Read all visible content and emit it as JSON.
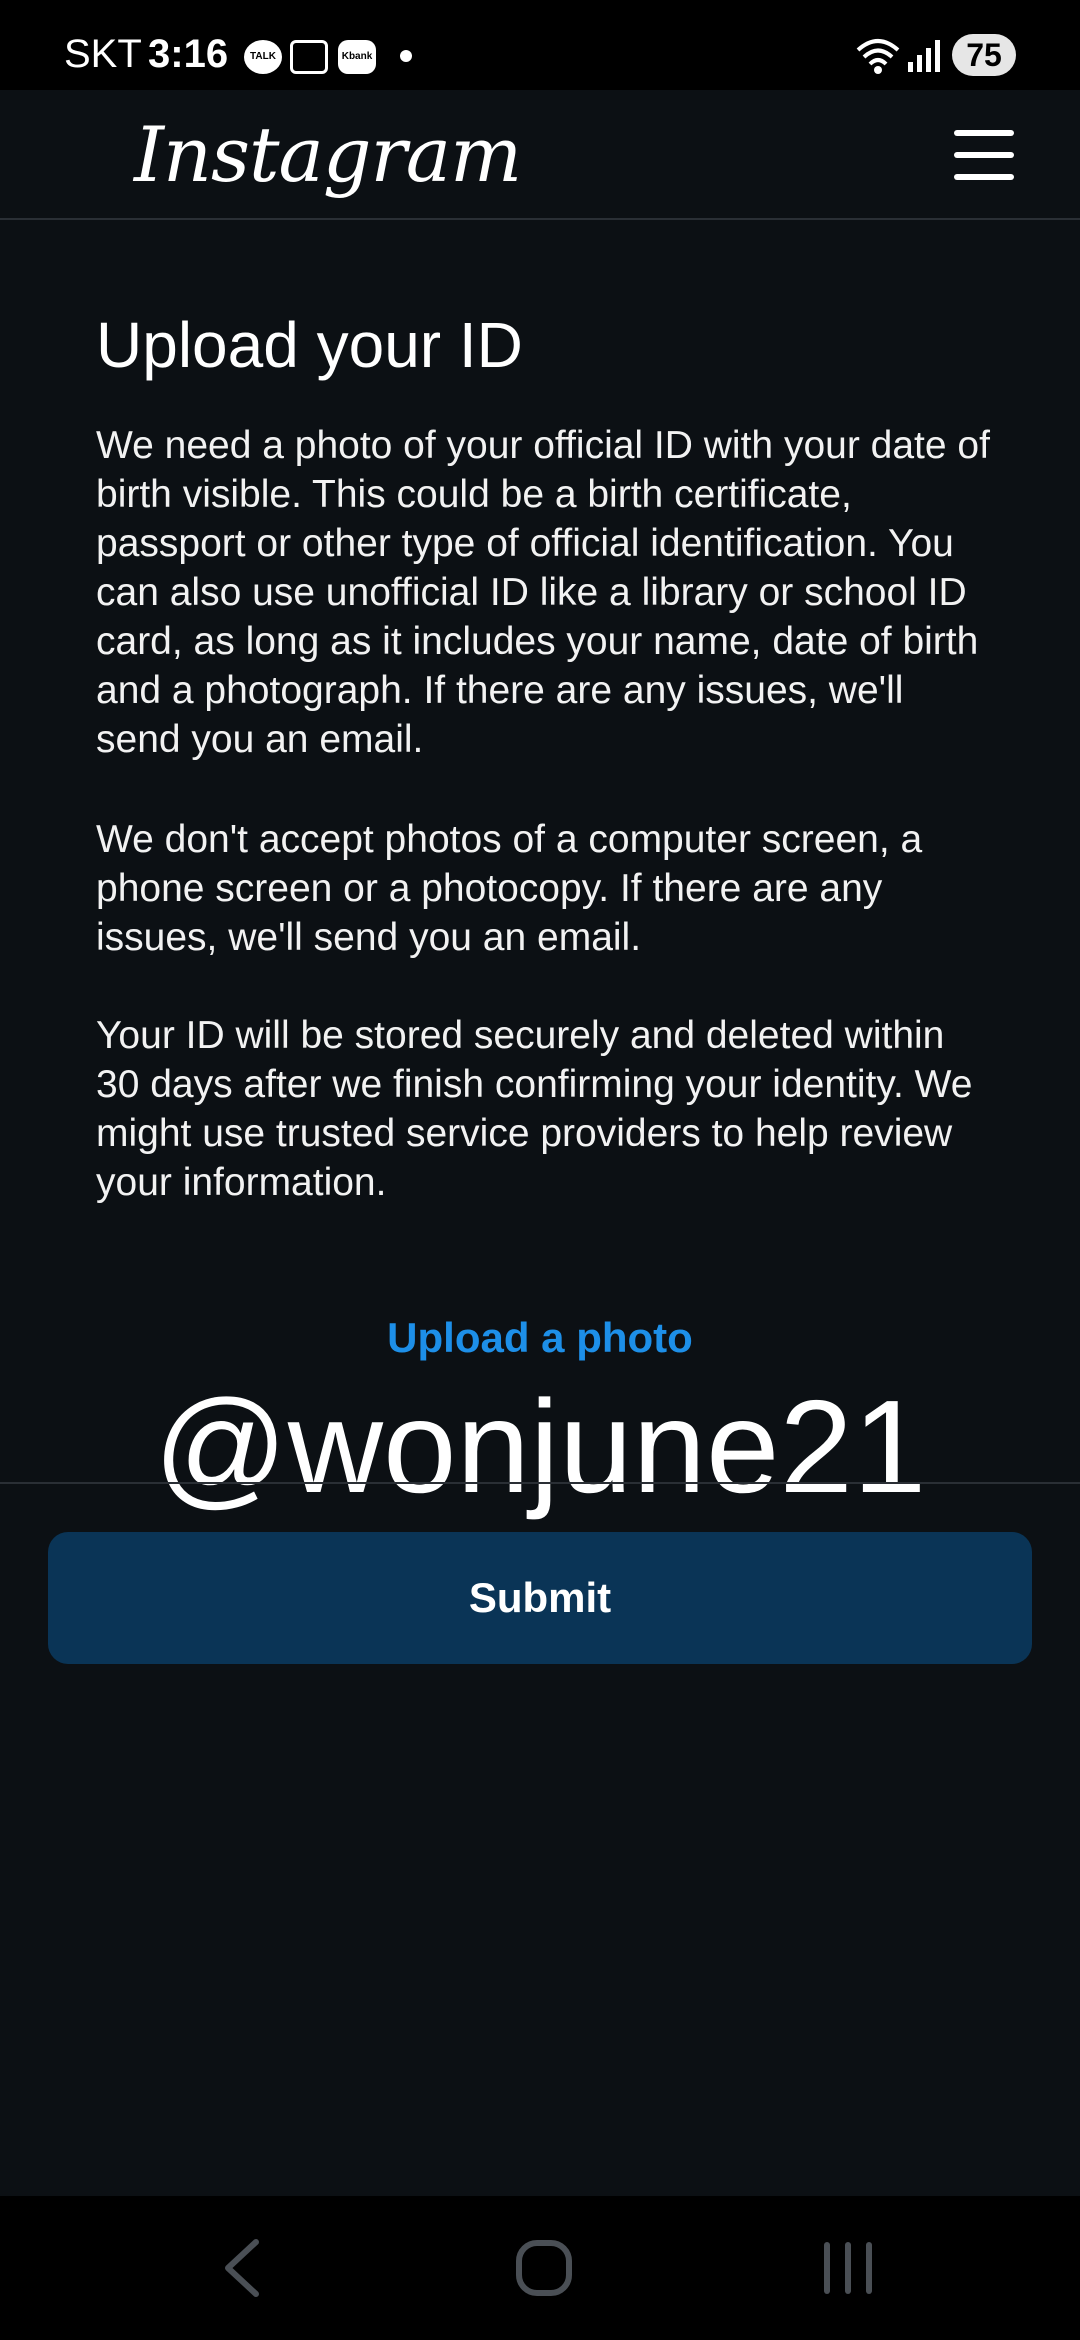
{
  "status_bar": {
    "carrier": "SKT",
    "time": "3:16",
    "notif_icons": [
      "kakaotalk-icon",
      "screenshot-icon",
      "kbank-icon"
    ],
    "talk_label": "TALK",
    "kbank_label": "Kbank",
    "battery": "75"
  },
  "header": {
    "logo": "Instagram",
    "menu_icon": "hamburger-menu-icon"
  },
  "main": {
    "title": "Upload your ID",
    "paragraphs": [
      "We need a photo of your official ID with your date of birth visible. This could be a birth certificate, passport or other type of official identification. You can also use unofficial ID like a library or school ID card, as long as it includes your name, date of birth and a photograph. If there are any issues, we'll send you an email.",
      "We don't accept photos of a computer screen, a phone screen or a photocopy. If there are any issues, we'll send you an email.",
      "Your ID will be stored securely and deleted within 30 days after we finish confirming your identity. We might use trusted service providers to help review your information."
    ],
    "upload_link": "Upload a photo",
    "watermark": "@wonjune21",
    "submit_label": "Submit"
  },
  "nav_bar": {
    "icons": [
      "back-icon",
      "home-icon",
      "recent-apps-icon"
    ]
  },
  "colors": {
    "background": "#0c1014",
    "link": "#1d8fe8",
    "submit_button": "#0a3456",
    "text": "#ffffff"
  }
}
